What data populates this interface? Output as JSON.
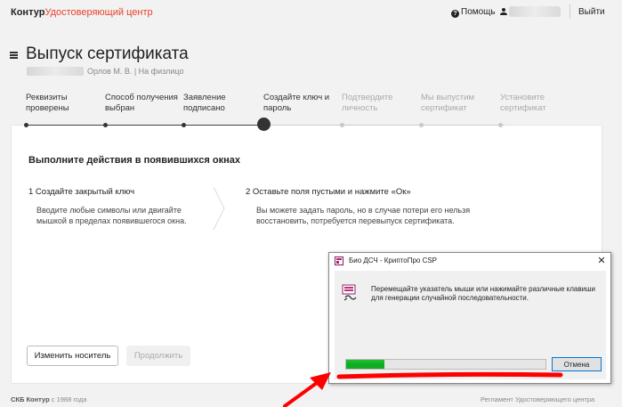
{
  "header": {
    "logo_main": "Контур",
    "logo_sub": "Удостоверяющий центр",
    "help_label": "Помощь",
    "logout_label": "Выйти"
  },
  "page": {
    "title": "Выпуск сертификата",
    "subject": "Орлов М. В.  |  На физлицо"
  },
  "steps": [
    {
      "label": "Реквизиты проверены",
      "state": "done"
    },
    {
      "label": "Способ получения выбран",
      "state": "done"
    },
    {
      "label": "Заявление подписано",
      "state": "done"
    },
    {
      "label": "Создайте ключ и пароль",
      "state": "active"
    },
    {
      "label": "Подтвердите личность",
      "state": "pending"
    },
    {
      "label": "Мы выпустим сертификат",
      "state": "pending"
    },
    {
      "label": "Установите сертификат",
      "state": "pending"
    }
  ],
  "card": {
    "title": "Выполните действия в появившихся окнах",
    "instructions": [
      {
        "title": "1  Создайте закрытый ключ",
        "text": "Вводите любые символы или двигайте мышкой в пределах появившегося окна."
      },
      {
        "title": "2  Оставьте поля пустыми и нажмите «Ок»",
        "text": "Вы можете задать пароль, но в случае потери его нельзя восстановить, потребуется перевыпуск сертификата."
      }
    ],
    "change_media_label": "Изменить носитель",
    "continue_label": "Продолжить"
  },
  "footer": {
    "brand": "СКБ Контур",
    "since": " с 1988 года",
    "regulation": "Регламент Удостоверяющего центра"
  },
  "dialog": {
    "title": "Био ДСЧ - КриптоПро CSP",
    "close_glyph": "✕",
    "message": "Перемещайте указатель мыши или нажимайте различные клавиши для генерации случайной последовательности.",
    "progress": 0.19,
    "cancel_label": "Отмена"
  },
  "colors": {
    "brand_red": "#e8412c",
    "progress_green": "#06b025",
    "annotation_red": "#ff0000"
  }
}
